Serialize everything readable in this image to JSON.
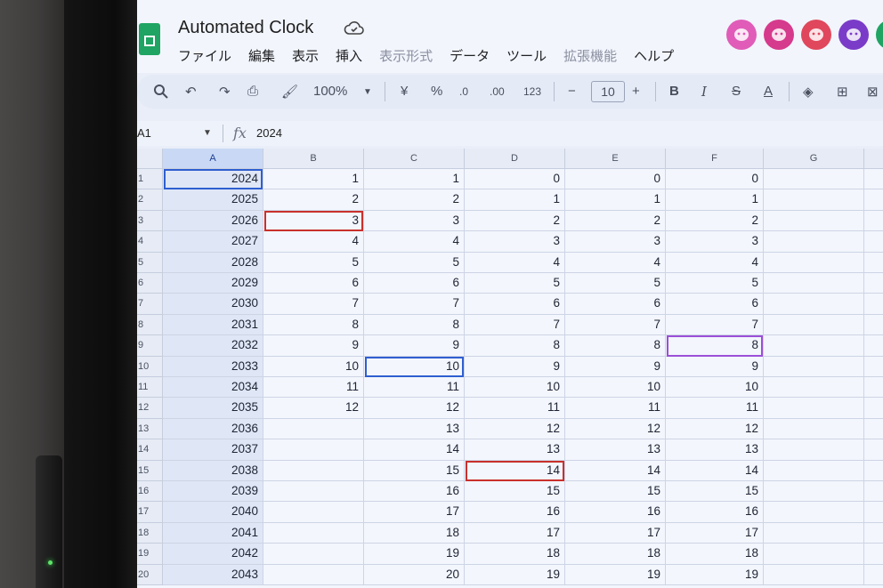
{
  "doc": {
    "title": "Automated Clock"
  },
  "menu": [
    "ファイル",
    "編集",
    "表示",
    "挿入",
    "表示形式",
    "データ",
    "ツール",
    "拡張機能",
    "ヘルプ"
  ],
  "toolbar": {
    "zoom": "100%",
    "currency": "¥",
    "percent": "%",
    "dec_decrease": ".0",
    "dec_increase": ".00",
    "number_format": "123",
    "font_size": "10",
    "minus": "−",
    "plus": "+",
    "bold": "B",
    "italic": "I",
    "strike": "S",
    "text_color": "A"
  },
  "formula_bar": {
    "name_box": "A1",
    "fx": "fx",
    "value": "2024"
  },
  "columns": [
    "A",
    "B",
    "C",
    "D",
    "E",
    "F",
    "G"
  ],
  "rows": [
    {
      "n": "1",
      "A": "2024",
      "B": "1",
      "C": "1",
      "D": "0",
      "E": "0",
      "F": "0"
    },
    {
      "n": "2",
      "A": "2025",
      "B": "2",
      "C": "2",
      "D": "1",
      "E": "1",
      "F": "1"
    },
    {
      "n": "3",
      "A": "2026",
      "B": "3",
      "C": "3",
      "D": "2",
      "E": "2",
      "F": "2"
    },
    {
      "n": "4",
      "A": "2027",
      "B": "4",
      "C": "4",
      "D": "3",
      "E": "3",
      "F": "3"
    },
    {
      "n": "5",
      "A": "2028",
      "B": "5",
      "C": "5",
      "D": "4",
      "E": "4",
      "F": "4"
    },
    {
      "n": "6",
      "A": "2029",
      "B": "6",
      "C": "6",
      "D": "5",
      "E": "5",
      "F": "5"
    },
    {
      "n": "7",
      "A": "2030",
      "B": "7",
      "C": "7",
      "D": "6",
      "E": "6",
      "F": "6"
    },
    {
      "n": "8",
      "A": "2031",
      "B": "8",
      "C": "8",
      "D": "7",
      "E": "7",
      "F": "7"
    },
    {
      "n": "9",
      "A": "2032",
      "B": "9",
      "C": "9",
      "D": "8",
      "E": "8",
      "F": "8"
    },
    {
      "n": "10",
      "A": "2033",
      "B": "10",
      "C": "10",
      "D": "9",
      "E": "9",
      "F": "9"
    },
    {
      "n": "11",
      "A": "2034",
      "B": "11",
      "C": "11",
      "D": "10",
      "E": "10",
      "F": "10"
    },
    {
      "n": "12",
      "A": "2035",
      "B": "12",
      "C": "12",
      "D": "11",
      "E": "11",
      "F": "11"
    },
    {
      "n": "13",
      "A": "2036",
      "B": "",
      "C": "13",
      "D": "12",
      "E": "12",
      "F": "12"
    },
    {
      "n": "14",
      "A": "2037",
      "B": "",
      "C": "14",
      "D": "13",
      "E": "13",
      "F": "13"
    },
    {
      "n": "15",
      "A": "2038",
      "B": "",
      "C": "15",
      "D": "14",
      "E": "14",
      "F": "14"
    },
    {
      "n": "16",
      "A": "2039",
      "B": "",
      "C": "16",
      "D": "15",
      "E": "15",
      "F": "15"
    },
    {
      "n": "17",
      "A": "2040",
      "B": "",
      "C": "17",
      "D": "16",
      "E": "16",
      "F": "16"
    },
    {
      "n": "18",
      "A": "2041",
      "B": "",
      "C": "18",
      "D": "17",
      "E": "17",
      "F": "17"
    },
    {
      "n": "19",
      "A": "2042",
      "B": "",
      "C": "19",
      "D": "18",
      "E": "18",
      "F": "18"
    },
    {
      "n": "20",
      "A": "2043",
      "B": "",
      "C": "20",
      "D": "19",
      "E": "19",
      "F": "19"
    }
  ],
  "highlights": [
    {
      "col": "B",
      "row": 3,
      "color": "#c9302c"
    },
    {
      "col": "C",
      "row": 10,
      "color": "#2f5fd0"
    },
    {
      "col": "D",
      "row": 15,
      "color": "#c9302c"
    },
    {
      "col": "F",
      "row": 9,
      "color": "#9b4fd8"
    },
    {
      "col": "A",
      "row": 1,
      "color": "#2f5fd0"
    }
  ],
  "colors": {
    "sheets_green": "#1fa463",
    "avatars": [
      "#e05cb8",
      "#d63a8c",
      "#e0475c",
      "#7a3cc8",
      "#1fa463"
    ]
  },
  "icons": {
    "avatars": [
      "ghost-avatar-icon",
      "cat-avatar-icon",
      "chat-avatar-icon",
      "nyan-avatar-icon",
      "green-avatar-icon"
    ]
  }
}
